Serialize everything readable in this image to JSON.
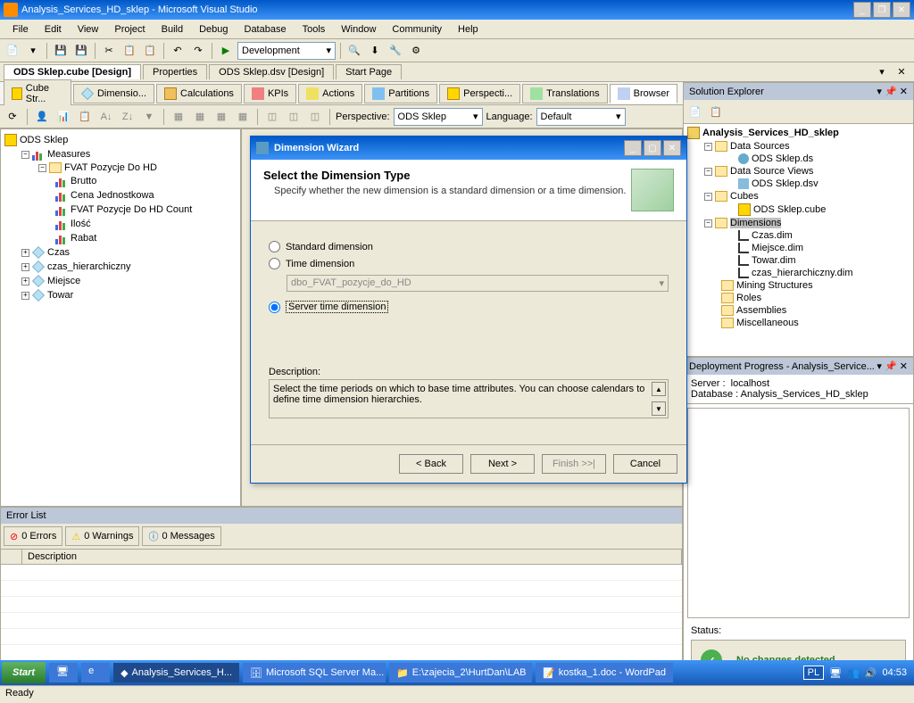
{
  "window": {
    "title": "Analysis_Services_HD_sklep - Microsoft Visual Studio"
  },
  "menu": [
    "File",
    "Edit",
    "View",
    "Project",
    "Build",
    "Debug",
    "Database",
    "Tools",
    "Window",
    "Community",
    "Help"
  ],
  "toolbar": {
    "config": "Development"
  },
  "doc_tabs": [
    {
      "label": "ODS Sklep.cube [Design]",
      "active": true
    },
    {
      "label": "Properties",
      "active": false
    },
    {
      "label": "ODS Sklep.dsv [Design]",
      "active": false
    },
    {
      "label": "Start Page",
      "active": false
    }
  ],
  "cube_tabs": [
    {
      "label": "Cube Str..."
    },
    {
      "label": "Dimensio..."
    },
    {
      "label": "Calculations"
    },
    {
      "label": "KPIs"
    },
    {
      "label": "Actions"
    },
    {
      "label": "Partitions"
    },
    {
      "label": "Perspecti..."
    },
    {
      "label": "Translations"
    },
    {
      "label": "Browser",
      "active": true
    }
  ],
  "perspective": {
    "label": "Perspective:",
    "value": "ODS Sklep",
    "lang_label": "Language:",
    "lang_value": "Default"
  },
  "cube_tree": {
    "root": "ODS Sklep",
    "measures": "Measures",
    "mgroup": "FVAT Pozycje Do HD",
    "items": [
      "Brutto",
      "Cena Jednostkowa",
      "FVAT Pozycje Do HD Count",
      "Ilość",
      "Rabat"
    ],
    "dims": [
      "Czas",
      "czas_hierarchiczny",
      "Miejsce",
      "Towar"
    ]
  },
  "error_list": {
    "title": "Error List",
    "errors": "0 Errors",
    "warnings": "0 Warnings",
    "messages": "0 Messages",
    "col_desc": "Description"
  },
  "solution": {
    "title": "Solution Explorer",
    "root": "Analysis_Services_HD_sklep",
    "nodes": {
      "ds": "Data Sources",
      "ds_item": "ODS Sklep.ds",
      "dsv": "Data Source Views",
      "dsv_item": "ODS Sklep.dsv",
      "cubes": "Cubes",
      "cube_item": "ODS Sklep.cube",
      "dims": "Dimensions",
      "dim_items": [
        "Czas.dim",
        "Miejsce.dim",
        "Towar.dim",
        "czas_hierarchiczny.dim"
      ],
      "mining": "Mining Structures",
      "roles": "Roles",
      "assemblies": "Assemblies",
      "misc": "Miscellaneous"
    }
  },
  "deploy": {
    "title": "Deployment Progress - Analysis_Service...",
    "server_label": "Server :",
    "server": "localhost",
    "db_label": "Database :",
    "db": "Analysis_Services_HD_sklep",
    "status_label": "Status:",
    "result": "No changes detected"
  },
  "status": "Ready",
  "taskbar": {
    "start": "Start",
    "items": [
      "Analysis_Services_H...",
      "Microsoft SQL Server Ma...",
      "E:\\zajecia_2\\HurtDan\\LAB",
      "kostka_1.doc - WordPad"
    ],
    "lang": "PL",
    "time": "04:53"
  },
  "dialog": {
    "title": "Dimension Wizard",
    "heading": "Select the Dimension Type",
    "sub": "Specify whether the new dimension is a standard dimension or a time dimension.",
    "opt1": "Standard dimension",
    "opt2": "Time dimension",
    "combo": "dbo_FVAT_pozycje_do_HD",
    "opt3": "Server time dimension",
    "desc_label": "Description:",
    "desc": "Select the time periods on which to base time attributes. You can choose calendars to define time dimension hierarchies.",
    "back": "< Back",
    "next": "Next >",
    "finish": "Finish >>|",
    "cancel": "Cancel"
  }
}
